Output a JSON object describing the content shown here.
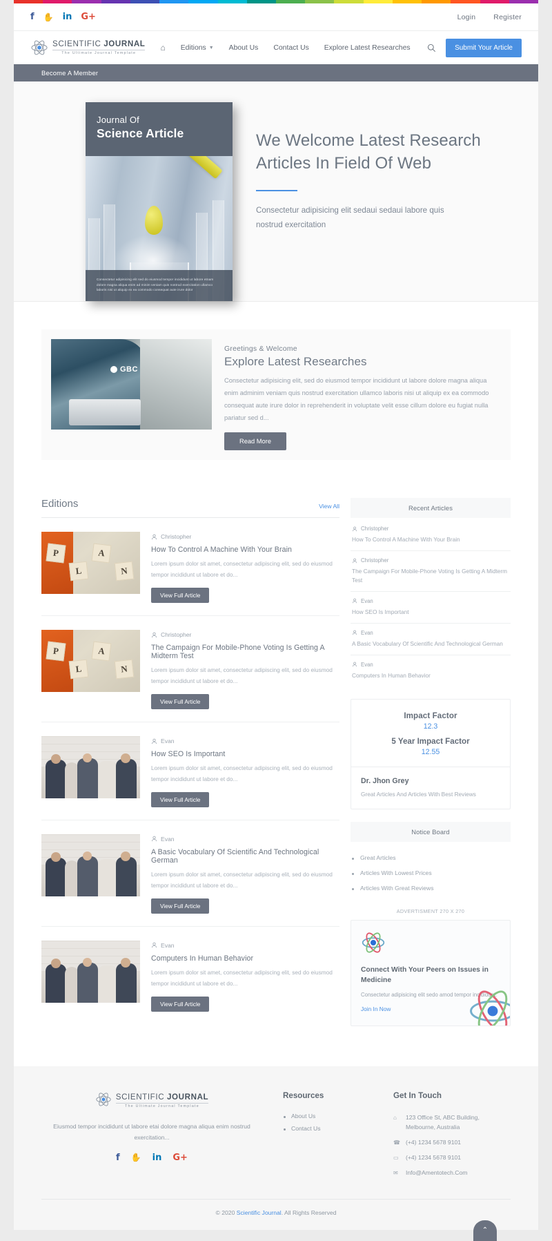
{
  "rainbow_colors": [
    "#e8322a",
    "#e01b6a",
    "#9b2fae",
    "#6634b0",
    "#3d50b4",
    "#2096f2",
    "#03a8f4",
    "#00bbd3",
    "#009587",
    "#4cae50",
    "#8bc24a",
    "#cddc39",
    "#ffec3a",
    "#ffc107",
    "#ff9800",
    "#ff5622",
    "#e01b6a",
    "#9b2fae"
  ],
  "topbar": {
    "social": [
      {
        "name": "facebook-icon",
        "glyph": "f",
        "color": "#3b5998"
      },
      {
        "name": "twitter-icon",
        "glyph": "ᵗ",
        "color": "#4aa8e8"
      },
      {
        "name": "linkedin-icon",
        "glyph": "in",
        "color": "#0077b5"
      },
      {
        "name": "googleplus-icon",
        "glyph": "G+",
        "color": "#dd4b39"
      }
    ],
    "login": "Login",
    "register": "Register"
  },
  "brand": {
    "title_light": "SCIENTIFIC ",
    "title_bold": "JOURNAL",
    "subtitle": "The Ultimate Journal Template"
  },
  "nav": {
    "home_icon": "⌂",
    "items": [
      {
        "label": "Editions",
        "has_caret": true
      },
      {
        "label": "About Us",
        "has_caret": false
      },
      {
        "label": "Contact Us",
        "has_caret": false
      },
      {
        "label": "Explore Latest Researches",
        "has_caret": false
      }
    ],
    "submit_button": "Submit Your Article"
  },
  "memberbar": {
    "label": "Become A Member"
  },
  "hero": {
    "cover_line1": "Journal Of",
    "cover_line2": "Science Article",
    "cover_caption": "Consectetur adipisicing elit sed do eiusmod tempor incididunt ut labore etnam dolore magna aliqua enim ad minim veniam quis nostrud exercitation ullamco laboris nisi ut aliquip ex ea commodo consequat aute irure dolor",
    "title": "We Welcome Latest Research Articles In Field Of Web",
    "subtitle": "Consectetur adipisicing elit sedaui sedaui labore quis nostrud exercitation",
    "accent": "#4a90e2"
  },
  "greetings": {
    "eyebrow": "Greetings & Welcome",
    "heading": "Explore Latest Researches",
    "paragraph": "Consectetur adipisicing elit, sed do eiusmod tempor incididunt ut labore dolore magna aliqua enim adminim veniam quis nostrud exercitation ullamco laboris nisi ut aliquip ex ea commodo consequat aute irure dolor in reprehenderit in voluptate velit esse cillum dolore eu fugiat nulla pariatur sed d...",
    "button": "Read More",
    "image_label": "GBC"
  },
  "editions": {
    "title": "Editions",
    "view_all": "View All",
    "button_label": "View Full Article",
    "excerpt": "Lorem ipsum dolor sit amet, consectetur adipiscing elit, sed do eiusmod tempor incididunt ut labore et do...",
    "articles": [
      {
        "author": "Christopher",
        "title": "How To Control A Machine With Your Brain",
        "thumb": "scrabble"
      },
      {
        "author": "Christopher",
        "title": "The Campaign For Mobile-Phone Voting Is Getting A Midterm Test",
        "thumb": "scrabble"
      },
      {
        "author": "Evan",
        "title": "How SEO Is Important",
        "thumb": "people"
      },
      {
        "author": "Evan",
        "title": "A Basic Vocabulary Of Scientific And Technological German",
        "thumb": "people"
      },
      {
        "author": "Evan",
        "title": "Computers In Human Behavior",
        "thumb": "people"
      }
    ]
  },
  "sidebar": {
    "recent": {
      "title": "Recent Articles",
      "items": [
        {
          "author": "Christopher",
          "title": "How To Control A Machine With Your Brain"
        },
        {
          "author": "Christopher",
          "title": "The Campaign For Mobile-Phone Voting Is Getting A Midterm Test"
        },
        {
          "author": "Evan",
          "title": "How SEO Is Important"
        },
        {
          "author": "Evan",
          "title": "A Basic Vocabulary Of Scientific And Technological German"
        },
        {
          "author": "Evan",
          "title": "Computers In Human Behavior"
        }
      ]
    },
    "impact": {
      "label1": "Impact Factor",
      "value1": "12.3",
      "label2": "5 Year Impact Factor",
      "value2": "12.55",
      "person": "Dr. Jhon Grey",
      "person_desc": "Great Articles And Articles With Best Reviews",
      "accent": "#4a90e2"
    },
    "notice": {
      "title": "Notice Board",
      "items": [
        "Great Articles",
        "Articles With Lowest Prices",
        "Articles With Great Reviews"
      ]
    },
    "ad": {
      "label": "ADVERTISMENT 270 X 270",
      "heading": "Connect With Your Peers on Issues in Medicine",
      "paragraph": "Consectetur adipisicing elit sedo amod tempor incididunt.",
      "link": "Join In Now"
    }
  },
  "scroll_top": {
    "glyph": "⌃"
  },
  "footer": {
    "brand_light": "SCIENTIFIC ",
    "brand_bold": "JOURNAL",
    "brand_sub": "The Ultimate Journal Template",
    "description": "Eiusmod tempor incididunt ut labore etai dolore magna aliqua enim nostrud exercitation...",
    "social": [
      {
        "name": "facebook-icon",
        "glyph": "f",
        "color": "#3b5998"
      },
      {
        "name": "twitter-icon",
        "glyph": "ᵗ",
        "color": "#4aa8e8"
      },
      {
        "name": "linkedin-icon",
        "glyph": "in",
        "color": "#0077b5"
      },
      {
        "name": "googleplus-icon",
        "glyph": "G+",
        "color": "#dd4b39"
      }
    ],
    "resources_title": "Resources",
    "resources": [
      "About Us",
      "Contact Us"
    ],
    "touch_title": "Get In Touch",
    "touch": [
      {
        "icon": "location-icon",
        "glyph": "⌂",
        "text": "123 Office St, ABC Building, Melbourne, Australia"
      },
      {
        "icon": "phone-icon",
        "glyph": "☎",
        "text": "(+4) 1234 5678 9101"
      },
      {
        "icon": "mobile-icon",
        "glyph": "▭",
        "text": "(+4) 1234 5678 9101"
      },
      {
        "icon": "mail-icon",
        "glyph": "✉",
        "text": "Info@Amentotech.Com"
      }
    ],
    "copy_prefix": "© 2020 ",
    "copy_link": "Scientific Journal",
    "copy_suffix": ". All Rights Reserved"
  }
}
